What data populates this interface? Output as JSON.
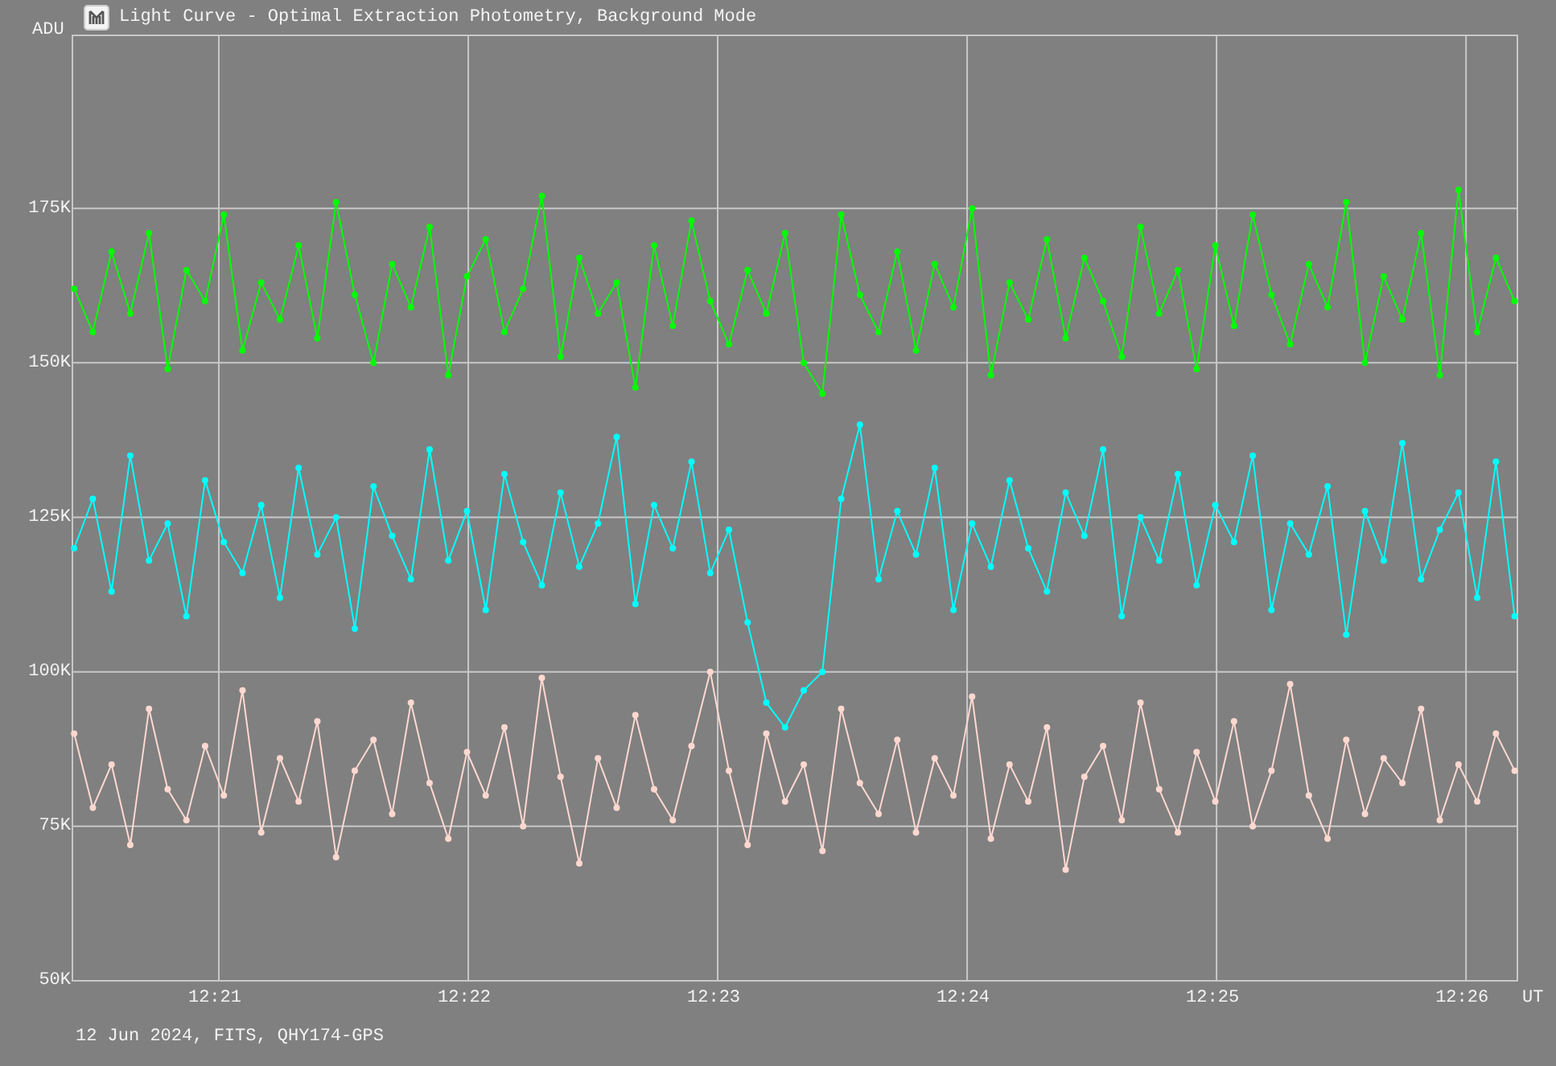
{
  "window": {
    "title": "Light Curve - Optimal Extraction Photometry, Background Mode"
  },
  "chart": {
    "chart_data": {
      "type": "line",
      "grid": true,
      "ylabel": "ADU",
      "xlabel": "UT",
      "xlim": [
        740.413,
        746.206
      ],
      "ylim": [
        50,
        203
      ],
      "xticks": [
        {
          "value": 741,
          "label": "12:21"
        },
        {
          "value": 742,
          "label": "12:22"
        },
        {
          "value": 743,
          "label": "12:23"
        },
        {
          "value": 744,
          "label": "12:24"
        },
        {
          "value": 745,
          "label": "12:25"
        },
        {
          "value": 746,
          "label": "12:26"
        }
      ],
      "yticks": [
        {
          "value": 175,
          "label": "175K"
        },
        {
          "value": 150,
          "label": "150K"
        },
        {
          "value": 125,
          "label": "125K"
        },
        {
          "value": 100,
          "label": "100K"
        },
        {
          "value": 75,
          "label": "75K"
        },
        {
          "value": 50,
          "label": "50K"
        }
      ],
      "x": [
        740.42,
        740.495,
        740.57,
        740.645,
        740.72,
        740.795,
        740.87,
        740.945,
        741.02,
        741.095,
        741.17,
        741.245,
        741.32,
        741.395,
        741.47,
        741.545,
        741.62,
        741.695,
        741.77,
        741.845,
        741.92,
        741.995,
        742.07,
        742.145,
        742.22,
        742.295,
        742.37,
        742.445,
        742.52,
        742.595,
        742.67,
        742.745,
        742.82,
        742.895,
        742.97,
        743.045,
        743.12,
        743.195,
        743.27,
        743.345,
        743.42,
        743.495,
        743.57,
        743.645,
        743.72,
        743.795,
        743.87,
        743.945,
        744.02,
        744.095,
        744.17,
        744.245,
        744.32,
        744.395,
        744.47,
        744.545,
        744.62,
        744.695,
        744.77,
        744.845,
        744.92,
        744.995,
        745.07,
        745.145,
        745.22,
        745.295,
        745.37,
        745.445,
        745.52,
        745.595,
        745.67,
        745.745,
        745.82,
        745.895,
        745.97,
        746.045,
        746.12,
        746.195
      ],
      "series": [
        {
          "color": "#00ff00",
          "marker": "o",
          "values": [
            162,
            155,
            168,
            158,
            171,
            149,
            165,
            160,
            174,
            152,
            163,
            157,
            169,
            154,
            176,
            161,
            150,
            166,
            159,
            172,
            148,
            164,
            170,
            155,
            162,
            177,
            151,
            167,
            158,
            163,
            146,
            169,
            156,
            173,
            160,
            153,
            165,
            158,
            171,
            150,
            145,
            174,
            161,
            155,
            168,
            152,
            166,
            159,
            175,
            148,
            163,
            157,
            170,
            154,
            167,
            160,
            151,
            172,
            158,
            165,
            149,
            169,
            156,
            174,
            161,
            153,
            166,
            159,
            176,
            150,
            164,
            157,
            171,
            148,
            178,
            155,
            167,
            160
          ]
        },
        {
          "color": "#00ffff",
          "marker": "o",
          "values": [
            120,
            128,
            113,
            135,
            118,
            124,
            109,
            131,
            121,
            116,
            127,
            112,
            133,
            119,
            125,
            107,
            130,
            122,
            115,
            136,
            118,
            126,
            110,
            132,
            121,
            114,
            129,
            117,
            124,
            138,
            111,
            127,
            120,
            134,
            116,
            123,
            108,
            95,
            91,
            97,
            100,
            128,
            140,
            115,
            126,
            119,
            133,
            110,
            124,
            117,
            131,
            120,
            113,
            129,
            122,
            136,
            109,
            125,
            118,
            132,
            114,
            127,
            121,
            135,
            110,
            124,
            119,
            130,
            106,
            126,
            118,
            137,
            115,
            123,
            129,
            112,
            134,
            109
          ]
        },
        {
          "color": "#ffd8d0",
          "marker": "o",
          "values": [
            90,
            78,
            85,
            72,
            94,
            81,
            76,
            88,
            80,
            97,
            74,
            86,
            79,
            92,
            70,
            84,
            89,
            77,
            95,
            82,
            73,
            87,
            80,
            91,
            75,
            99,
            83,
            69,
            86,
            78,
            93,
            81,
            76,
            88,
            100,
            84,
            72,
            90,
            79,
            85,
            71,
            94,
            82,
            77,
            89,
            74,
            86,
            80,
            96,
            73,
            85,
            79,
            91,
            68,
            83,
            88,
            76,
            95,
            81,
            74,
            87,
            79,
            92,
            75,
            84,
            98,
            80,
            73,
            89,
            77,
            86,
            82,
            94,
            76,
            85,
            79,
            90,
            84
          ]
        }
      ]
    }
  },
  "footer": "12 Jun 2024, FITS, QHY174-GPS"
}
